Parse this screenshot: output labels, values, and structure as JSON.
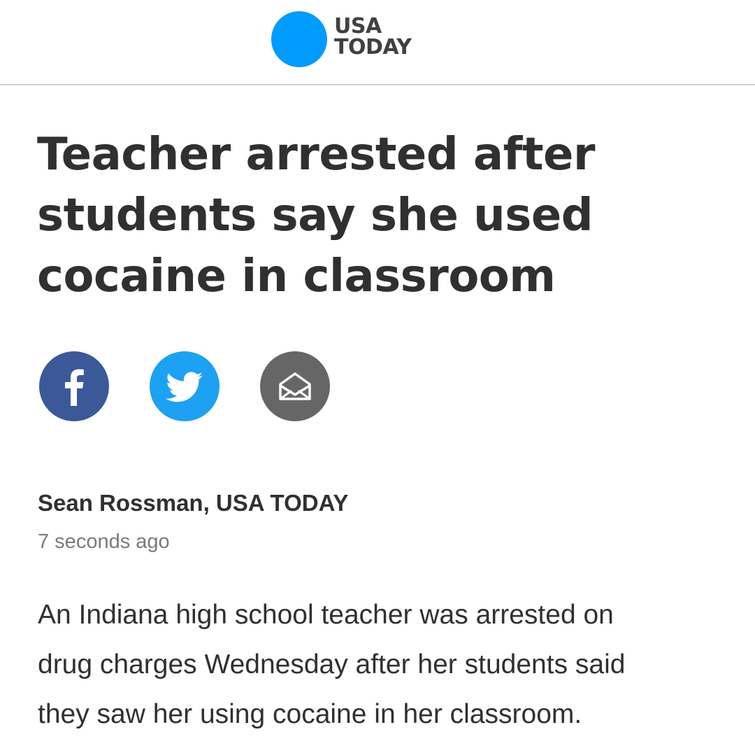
{
  "masthead": {
    "logo_line1": "USA",
    "logo_line2": "TODAY",
    "brand_color": "#009bff",
    "logo_icon": "usa-today-dot-logo"
  },
  "article": {
    "headline_lines": [
      "Teacher arrested after",
      "students say she used",
      "cocaine in classroom"
    ],
    "byline": "Sean Rossman, USA TODAY",
    "timestamp": "7 seconds ago",
    "body_lines": [
      "An Indiana high school teacher was arrested on",
      "drug charges Wednesday after her students said",
      "they saw her using cocaine in her classroom."
    ]
  },
  "share": {
    "facebook": {
      "icon": "facebook-icon",
      "color": "#3b5998"
    },
    "twitter": {
      "icon": "twitter-icon",
      "color": "#1da1f2"
    },
    "email": {
      "icon": "email-icon",
      "color": "#666666"
    }
  }
}
